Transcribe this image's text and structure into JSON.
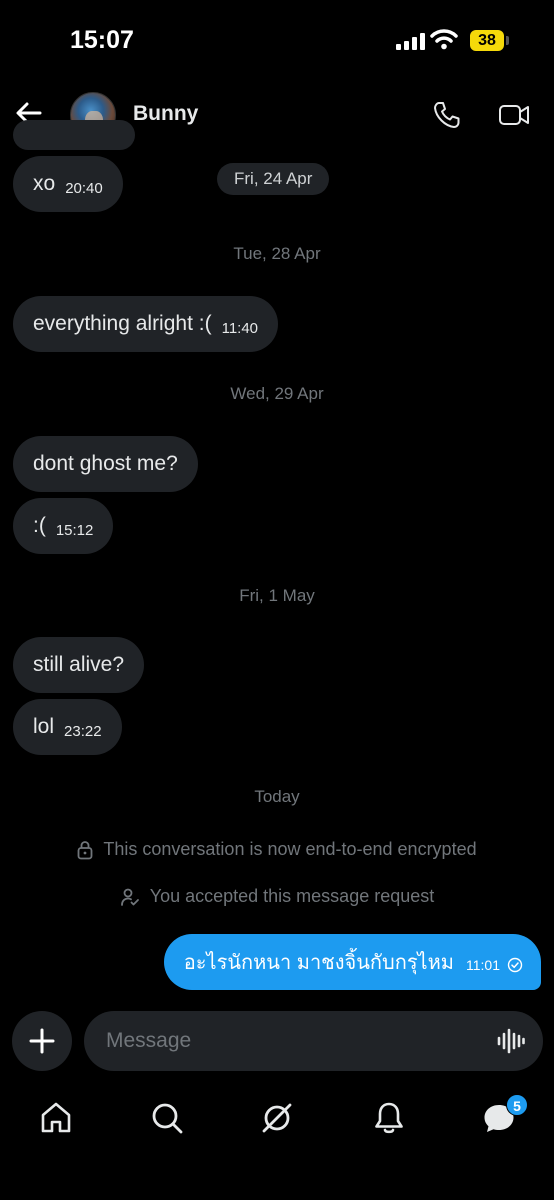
{
  "status_bar": {
    "time": "15:07",
    "battery": "38"
  },
  "header": {
    "contact_name": "Bunny"
  },
  "messages": [
    {
      "text": "xo",
      "time": "20:40"
    },
    {
      "text": "everything alright :(",
      "time": "11:40"
    },
    {
      "text": "dont ghost me?",
      "time": ""
    },
    {
      "text": ":(",
      "time": "15:12"
    },
    {
      "text": "still alive?",
      "time": ""
    },
    {
      "text": "lol",
      "time": "23:22"
    }
  ],
  "date_separators": [
    "Fri, 24 Apr",
    "Tue, 28 Apr",
    "Wed, 29 Apr",
    "Fri, 1 May",
    "Today"
  ],
  "system_notices": {
    "encrypted": "This conversation is now end-to-end encrypted",
    "accepted": "You accepted this message request"
  },
  "outgoing": {
    "text": "อะไรนักหนา มาชงจิ้นกับกรุไหม",
    "time": "11:01"
  },
  "composer": {
    "placeholder": "Message"
  },
  "tabbar": {
    "messages_badge": "5"
  },
  "colors": {
    "accent": "#1d9bf0",
    "bubble": "#202327",
    "muted": "#71767b",
    "battery": "#f5d90a"
  },
  "icons": [
    "back-arrow-icon",
    "phone-icon",
    "video-icon",
    "plus-icon",
    "voice-wave-icon",
    "home-icon",
    "search-icon",
    "grok-icon",
    "bell-icon",
    "messages-icon",
    "lock-icon",
    "person-check-icon",
    "sent-check-icon"
  ]
}
